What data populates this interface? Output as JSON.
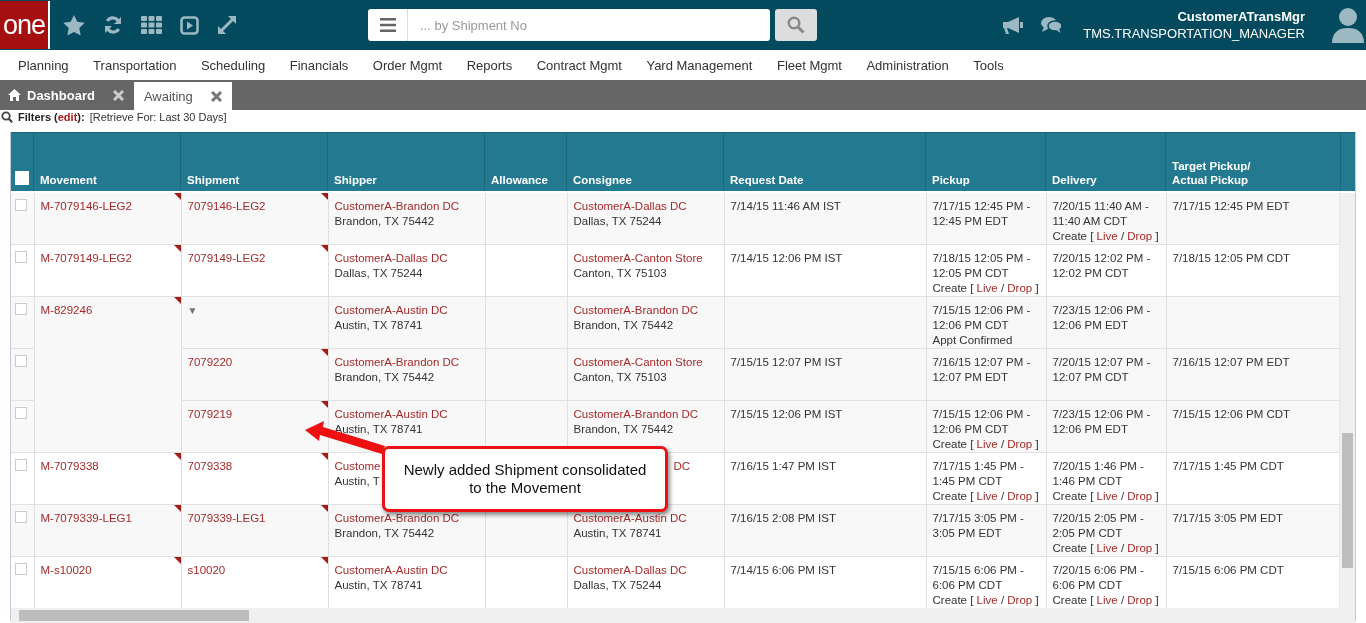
{
  "topbar": {
    "logo": "one",
    "search": {
      "placeholder": "... by Shipment No"
    },
    "user": {
      "name": "CustomerATransMgr",
      "role": "TMS.TRANSPORTATION_MANAGER"
    }
  },
  "menu": [
    "Planning",
    "Transportation",
    "Scheduling",
    "Financials",
    "Order Mgmt",
    "Reports",
    "Contract Mgmt",
    "Yard Management",
    "Fleet Mgmt",
    "Administration",
    "Tools"
  ],
  "tabs": [
    {
      "label": "Dashboard",
      "kind": "home",
      "selected": false
    },
    {
      "label": "Awaiting",
      "kind": "plain",
      "selected": true
    }
  ],
  "filters": {
    "label": "Filters (",
    "edit": "edit",
    "close": "):",
    "value": "[Retrieve For: Last 30 Days]"
  },
  "table": {
    "select_all": {
      "checked": false
    },
    "columns": [
      "Movement",
      "Shipment",
      "Shipper",
      "Allowance",
      "Consignee",
      "Request Date",
      "Pickup",
      "Delivery",
      "Target Pickup/\nActual Pickup"
    ],
    "groups": [
      {
        "movement": "M-7079146-LEG2",
        "flag": true,
        "shipments": [
          {
            "checked": false,
            "shipment": {
              "kind": "link",
              "text": "7079146-LEG2",
              "flag": true
            },
            "shipper": {
              "name": "CustomerA-Brandon DC",
              "city": "Brandon, TX 75442"
            },
            "consignee": {
              "name": "CustomerA-Dallas DC",
              "city": "Dallas, TX 75244"
            },
            "request_date": "7/14/15 11:46 AM IST",
            "pickup": {
              "lines": [
                "7/17/15 12:45 PM -",
                "12:45 PM EDT"
              ]
            },
            "delivery": {
              "lines": [
                "7/20/15 11:40 AM -",
                "11:40 AM CDT"
              ],
              "action": {
                "kind": "links",
                "prefix": "Create [",
                "live": "Live",
                "separator": "/",
                "drop": "Drop",
                "suffix": "]"
              }
            },
            "target": "7/17/15 12:45 PM EDT"
          }
        ]
      },
      {
        "movement": "M-7079149-LEG2",
        "flag": true,
        "shipments": [
          {
            "checked": false,
            "shipment": {
              "kind": "link",
              "text": "7079149-LEG2",
              "flag": true
            },
            "shipper": {
              "name": "CustomerA-Dallas DC",
              "city": "Dallas, TX 75244"
            },
            "consignee": {
              "name": "CustomerA-Canton Store",
              "city": "Canton, TX 75103"
            },
            "request_date": "7/14/15 12:06 PM IST",
            "pickup": {
              "lines": [
                "7/18/15 12:05 PM -",
                "12:05 PM CDT"
              ],
              "action": {
                "kind": "links",
                "prefix": "Create [",
                "live": "Live",
                "separator": "/",
                "drop": "Drop",
                "suffix": "]"
              }
            },
            "delivery": {
              "lines": [
                "7/20/15 12:02 PM -",
                "12:02 PM CDT"
              ]
            },
            "target": "7/18/15 12:05 PM CDT"
          }
        ]
      },
      {
        "movement": "M-829246",
        "flag": true,
        "shipments": [
          {
            "checked": false,
            "shipment": {
              "kind": "expander",
              "text": "▼"
            },
            "shipper": {
              "name": "CustomerA-Austin DC",
              "city": "Austin, TX 78741"
            },
            "consignee": {
              "name": "CustomerA-Brandon DC",
              "city": "Brandon, TX 75442"
            },
            "pickup": {
              "lines": [
                "7/15/15 12:06 PM -",
                "12:06 PM CDT"
              ],
              "action": {
                "kind": "note",
                "text": "Appt Confirmed"
              }
            },
            "delivery": {
              "lines": [
                "7/23/15 12:06 PM -",
                "12:06 PM EDT"
              ]
            }
          },
          {
            "checked": false,
            "shipment": {
              "kind": "link",
              "text": "7079220",
              "flag": true
            },
            "shipper": {
              "name": "CustomerA-Brandon DC",
              "city": "Brandon, TX 75442"
            },
            "consignee": {
              "name": "CustomerA-Canton Store",
              "city": "Canton, TX 75103"
            },
            "request_date": "7/15/15 12:07 PM IST",
            "pickup": {
              "lines": [
                "7/16/15 12:07 PM -",
                "12:07 PM EDT"
              ]
            },
            "delivery": {
              "lines": [
                "7/20/15 12:07 PM -",
                "12:07 PM CDT"
              ]
            },
            "target": "7/16/15 12:07 PM EDT"
          },
          {
            "checked": false,
            "shipment": {
              "kind": "link",
              "text": "7079219",
              "flag": true
            },
            "shipper": {
              "name": "CustomerA-Austin DC",
              "city": "Austin, TX 78741"
            },
            "consignee": {
              "name": "CustomerA-Brandon DC",
              "city": "Brandon, TX 75442"
            },
            "request_date": "7/15/15 12:06 PM IST",
            "pickup": {
              "lines": [
                "7/15/15 12:06 PM -",
                "12:06 PM CDT"
              ],
              "action": {
                "kind": "links",
                "prefix": "Create [",
                "live": "Live",
                "separator": "/",
                "drop": "Drop",
                "suffix": "]"
              }
            },
            "delivery": {
              "lines": [
                "7/23/15 12:06 PM -",
                "12:06 PM EDT"
              ]
            },
            "target": "7/15/15 12:06 PM CDT"
          }
        ]
      },
      {
        "movement": "M-7079338",
        "flag": true,
        "shipments": [
          {
            "checked": false,
            "shipment": {
              "kind": "link",
              "text": "7079338",
              "flag": true
            },
            "shipper": {
              "name": "Custome",
              "city": "Austin, T"
            },
            "consignee": {
              "name": "DC",
              "partial": true
            },
            "request_date": "7/16/15 1:47 PM IST",
            "pickup": {
              "lines": [
                "7/17/15 1:45 PM -",
                "1:45 PM CDT"
              ],
              "action": {
                "kind": "links",
                "prefix": "Create [",
                "live": "Live",
                "separator": "/",
                "drop": "Drop",
                "suffix": "]"
              }
            },
            "delivery": {
              "lines": [
                "7/20/15 1:46 PM -",
                "1:46 PM CDT"
              ],
              "action": {
                "kind": "links",
                "prefix": "Create [",
                "live": "Live",
                "separator": "/",
                "drop": "Drop",
                "suffix": "]"
              }
            },
            "target": "7/17/15 1:45 PM CDT"
          }
        ]
      },
      {
        "movement": "M-7079339-LEG1",
        "flag": true,
        "shipments": [
          {
            "checked": false,
            "shipment": {
              "kind": "link",
              "text": "7079339-LEG1",
              "flag": true
            },
            "shipper": {
              "name": "CustomerA-Brandon DC",
              "city": "Brandon, TX 75442"
            },
            "consignee": {
              "name": "CustomerA-Austin DC",
              "city": "Austin, TX 78741"
            },
            "request_date": "7/16/15 2:08 PM IST",
            "pickup": {
              "lines": [
                "7/17/15 3:05 PM -",
                "3:05 PM EDT"
              ]
            },
            "delivery": {
              "lines": [
                "7/20/15 2:05 PM -",
                "2:05 PM CDT"
              ],
              "action": {
                "kind": "links",
                "prefix": "Create [",
                "live": "Live",
                "separator": "/",
                "drop": "Drop",
                "suffix": "]"
              }
            },
            "target": "7/17/15 3:05 PM EDT"
          }
        ]
      },
      {
        "movement": "M-s10020",
        "flag": true,
        "shipments": [
          {
            "checked": false,
            "shipment": {
              "kind": "link",
              "text": "s10020",
              "flag": true
            },
            "shipper": {
              "name": "CustomerA-Austin DC",
              "city": "Austin, TX 78741"
            },
            "consignee": {
              "name": "CustomerA-Dallas DC",
              "city": "Dallas, TX 75244"
            },
            "request_date": "7/14/15 6:06 PM IST",
            "pickup": {
              "lines": [
                "7/15/15 6:06 PM -",
                "6:06 PM CDT"
              ],
              "action": {
                "kind": "links",
                "prefix": "Create [",
                "live": "Live",
                "separator": "/",
                "drop": "Drop",
                "suffix": "]"
              }
            },
            "delivery": {
              "lines": [
                "7/20/15 6:06 PM -",
                "6:06 PM CDT"
              ],
              "action": {
                "kind": "links",
                "prefix": "Create [",
                "live": "Live",
                "separator": "/",
                "drop": "Drop",
                "suffix": "]"
              }
            },
            "target": "7/15/15 6:06 PM CDT"
          }
        ]
      }
    ]
  },
  "callout": {
    "text": "Newly added Shipment consolidated to the Movement"
  }
}
